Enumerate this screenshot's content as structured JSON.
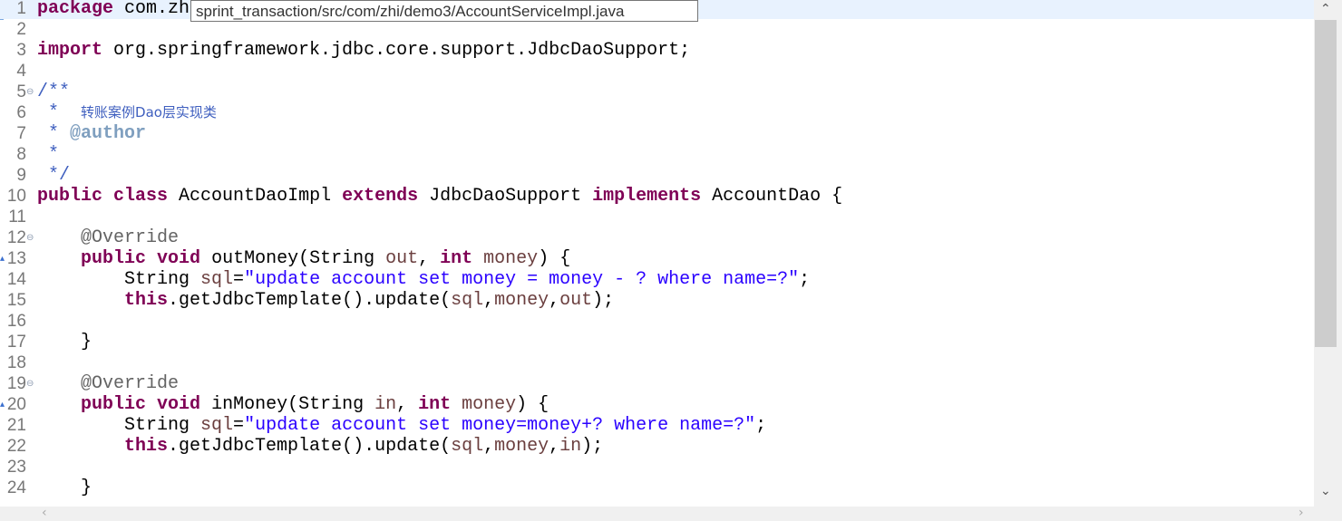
{
  "tooltip": "sprint_transaction/src/com/zhi/demo3/AccountServiceImpl.java",
  "colors": {
    "keyword": "#7f0055",
    "string": "#2a00ff",
    "variable": "#6a3e3e",
    "javadoc": "#3f5fbf",
    "javadoc_tag": "#7f9fbf",
    "annotation": "#646464",
    "current_line": "#e8f2fe"
  },
  "lines": [
    {
      "n": "1",
      "current": true,
      "tokens": [
        [
          "k",
          "package"
        ],
        [
          "p",
          " com.zh"
        ]
      ]
    },
    {
      "n": "2",
      "tokens": []
    },
    {
      "n": "3",
      "tokens": [
        [
          "k",
          "import"
        ],
        [
          "p",
          " org.springframework.jdbc.core.support.JdbcDaoSupport;"
        ]
      ]
    },
    {
      "n": "4",
      "tokens": []
    },
    {
      "n": "5",
      "fold": true,
      "tokens": [
        [
          "c",
          "/**"
        ]
      ]
    },
    {
      "n": "6",
      "tokens": [
        [
          "c",
          " *  "
        ],
        [
          "c cjk",
          "转账案例Dao层实现类"
        ]
      ]
    },
    {
      "n": "7",
      "tokens": [
        [
          "c",
          " * "
        ],
        [
          "t",
          "@author"
        ]
      ]
    },
    {
      "n": "8",
      "tokens": [
        [
          "c",
          " *"
        ]
      ]
    },
    {
      "n": "9",
      "tokens": [
        [
          "c",
          " */"
        ]
      ]
    },
    {
      "n": "10",
      "tokens": [
        [
          "k",
          "public"
        ],
        [
          "p",
          " "
        ],
        [
          "k",
          "class"
        ],
        [
          "p",
          " AccountDaoImpl "
        ],
        [
          "k",
          "extends"
        ],
        [
          "p",
          " JdbcDaoSupport "
        ],
        [
          "k",
          "implements"
        ],
        [
          "p",
          " AccountDao {"
        ]
      ]
    },
    {
      "n": "11",
      "tokens": []
    },
    {
      "n": "12",
      "fold": true,
      "tokens": [
        [
          "p",
          "    "
        ],
        [
          "a",
          "@Override"
        ]
      ]
    },
    {
      "n": "13",
      "override": true,
      "tokens": [
        [
          "p",
          "    "
        ],
        [
          "k",
          "public"
        ],
        [
          "p",
          " "
        ],
        [
          "k",
          "void"
        ],
        [
          "p",
          " outMoney(String "
        ],
        [
          "v",
          "out"
        ],
        [
          "p",
          ", "
        ],
        [
          "k",
          "int"
        ],
        [
          "p",
          " "
        ],
        [
          "v",
          "money"
        ],
        [
          "p",
          ") {"
        ]
      ]
    },
    {
      "n": "14",
      "tokens": [
        [
          "p",
          "        String "
        ],
        [
          "v",
          "sql"
        ],
        [
          "p",
          "="
        ],
        [
          "s",
          "\"update account set money = money - ? where name=?\""
        ],
        [
          "p",
          ";"
        ]
      ]
    },
    {
      "n": "15",
      "tokens": [
        [
          "p",
          "        "
        ],
        [
          "k",
          "this"
        ],
        [
          "p",
          ".getJdbcTemplate().update("
        ],
        [
          "v",
          "sql"
        ],
        [
          "p",
          ","
        ],
        [
          "v",
          "money"
        ],
        [
          "p",
          ","
        ],
        [
          "v",
          "out"
        ],
        [
          "p",
          ");"
        ]
      ]
    },
    {
      "n": "16",
      "tokens": []
    },
    {
      "n": "17",
      "tokens": [
        [
          "p",
          "    }"
        ]
      ]
    },
    {
      "n": "18",
      "tokens": []
    },
    {
      "n": "19",
      "fold": true,
      "tokens": [
        [
          "p",
          "    "
        ],
        [
          "a",
          "@Override"
        ]
      ]
    },
    {
      "n": "20",
      "override": true,
      "tokens": [
        [
          "p",
          "    "
        ],
        [
          "k",
          "public"
        ],
        [
          "p",
          " "
        ],
        [
          "k",
          "void"
        ],
        [
          "p",
          " inMoney(String "
        ],
        [
          "v",
          "in"
        ],
        [
          "p",
          ", "
        ],
        [
          "k",
          "int"
        ],
        [
          "p",
          " "
        ],
        [
          "v",
          "money"
        ],
        [
          "p",
          ") {"
        ]
      ]
    },
    {
      "n": "21",
      "tokens": [
        [
          "p",
          "        String "
        ],
        [
          "v",
          "sql"
        ],
        [
          "p",
          "="
        ],
        [
          "s",
          "\"update account set money=money+? where name=?\""
        ],
        [
          "p",
          ";"
        ]
      ]
    },
    {
      "n": "22",
      "tokens": [
        [
          "p",
          "        "
        ],
        [
          "k",
          "this"
        ],
        [
          "p",
          ".getJdbcTemplate().update("
        ],
        [
          "v",
          "sql"
        ],
        [
          "p",
          ","
        ],
        [
          "v",
          "money"
        ],
        [
          "p",
          ","
        ],
        [
          "v",
          "in"
        ],
        [
          "p",
          ");"
        ]
      ]
    },
    {
      "n": "23",
      "tokens": []
    },
    {
      "n": "24",
      "tokens": [
        [
          "p",
          "    }"
        ]
      ]
    }
  ]
}
